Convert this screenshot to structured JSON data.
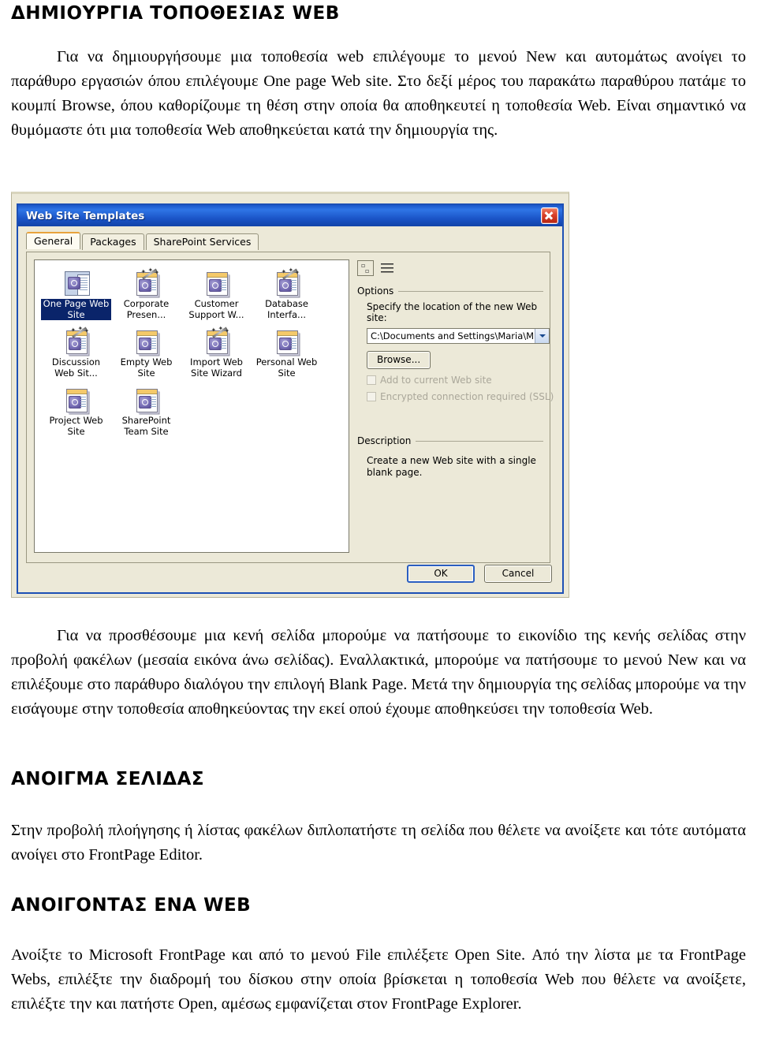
{
  "document": {
    "headings": {
      "create_site": "ΔΗΜΙΟΥΡΓΙΑ ΤΟΠΟΘΕΣΙΑΣ WEB",
      "open_page": "ΑΝΟΙΓΜΑ ΣΕΛΙΔΑΣ",
      "open_web": "ΑΝΟΙΓΟΝΤΑΣ ΕΝΑ WEB"
    },
    "paragraphs": {
      "intro": "Για να δημιουργήσουμε μια τοποθεσία web επιλέγουμε το μενού New και αυτομάτως ανοίγει το παράθυρο εργασιών όπου επιλέγουμε One page Web site. Στο δεξί μέρος του παρακάτω παραθύρου πατάμε το κουμπί Browse, όπου καθορίζουμε τη θέση στην οποία θα αποθηκευτεί η τοποθεσία Web. Είναι σημαντικό να θυμόμαστε ότι μια τοποθεσία Web αποθηκεύεται κατά την δημιουργία της.",
      "blank_page": "Για να προσθέσουμε μια κενή σελίδα μπορούμε να πατήσουμε το εικονίδιο της κενής σελίδας στην προβολή φακέλων (μεσαία εικόνα άνω σελίδας). Εναλλακτικά, μπορούμε να πατήσουμε το μενού New και να επιλέξουμε στο παράθυρο διαλόγου την επιλογή Blank Page. Μετά την δημιουργία της σελίδας μπορούμε να την εισάγουμε στην τοποθεσία αποθηκεύοντας την εκεί οπού έχουμε αποθηκεύσει την τοποθεσία Web.",
      "open_page": "Στην προβολή πλοήγησης ή λίστας φακέλων διπλοπατήστε τη σελίδα που θέλετε να ανοίξετε και τότε αυτόματα ανοίγει στο FrontPage Editor.",
      "open_web": "Ανοίξτε το Microsoft FrontPage και από το μενού File επιλέξετε Open Site. Από την λίστα με τα FrontPage Webs, επιλέξτε την διαδρομή του δίσκου στην οποία βρίσκεται η τοποθεσία Web που θέλετε να ανοίξετε, επιλέξτε την και πατήστε Open, αμέσως εμφανίζεται στον FrontPage Explorer."
    }
  },
  "screenshot": {
    "dialog": {
      "title": "Web Site Templates",
      "close_label": "×",
      "tabs": [
        {
          "label": "General",
          "active": true
        },
        {
          "label": "Packages",
          "active": false
        },
        {
          "label": "SharePoint Services",
          "active": false
        }
      ],
      "templates": [
        {
          "label": "One Page Web Site",
          "selected": true,
          "wizard": false,
          "big": true
        },
        {
          "label": "Corporate Presen...",
          "selected": false,
          "wizard": true,
          "big": false
        },
        {
          "label": "Customer Support W...",
          "selected": false,
          "wizard": false,
          "big": false
        },
        {
          "label": "Database Interfa...",
          "selected": false,
          "wizard": true,
          "big": false
        },
        {
          "label": "Discussion Web Sit...",
          "selected": false,
          "wizard": true,
          "big": false
        },
        {
          "label": "Empty Web Site",
          "selected": false,
          "wizard": false,
          "big": false
        },
        {
          "label": "Import Web Site Wizard",
          "selected": false,
          "wizard": true,
          "big": false
        },
        {
          "label": "Personal Web Site",
          "selected": false,
          "wizard": false,
          "big": false
        },
        {
          "label": "Project Web Site",
          "selected": false,
          "wizard": false,
          "big": false
        },
        {
          "label": "SharePoint Team Site",
          "selected": false,
          "wizard": false,
          "big": false
        }
      ],
      "options": {
        "group_title": "Options",
        "location_label": "Specify the location of the new Web site:",
        "location_value": "C:\\Documents and Settings\\Maria\\M",
        "browse_button": "Browse...",
        "checkbox_add": "Add to current Web site",
        "checkbox_ssl": "Encrypted connection required (SSL)"
      },
      "description": {
        "group_title": "Description",
        "text": "Create a new Web site with a single blank page."
      },
      "buttons": {
        "ok": "OK",
        "cancel": "Cancel"
      },
      "colors": {
        "titlebar_blue": "#1b56c9",
        "selection_blue": "#0a246a",
        "dialog_face": "#ece9d8",
        "tab_accent": "#e8a33d",
        "close_red": "#d9412a"
      }
    }
  }
}
